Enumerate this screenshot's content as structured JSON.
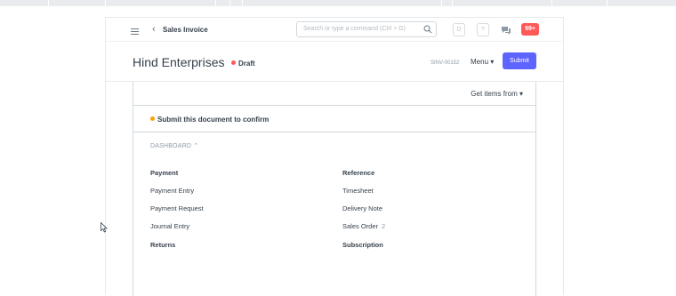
{
  "navbar": {
    "breadcrumb": "Sales Invoice",
    "search_placeholder": "Search or type a command (Ctrl + G)",
    "icon_d": "D",
    "icon_help": "?",
    "notification_count": "99+"
  },
  "header": {
    "title": "Hind Enterprises",
    "status": "Draft",
    "doc_id": "SINV-00152",
    "menu_label": "Menu ▾",
    "submit_label": "Submit"
  },
  "form": {
    "get_items_label": "Get items from ▾",
    "alert_text": "Submit this document to confirm"
  },
  "dashboard": {
    "label": "DASHBOARD ⌃",
    "columns": [
      {
        "heading": "Payment",
        "items": [
          "Payment Entry",
          "Payment Request",
          "Journal Entry"
        ],
        "next_heading": "Returns"
      },
      {
        "heading": "Reference",
        "items": [
          "Timesheet",
          "Delivery Note",
          "Sales Order"
        ],
        "count": "2",
        "next_heading": "Subscription"
      }
    ]
  },
  "colors": {
    "primary": "#5e64ff",
    "draft": "#ff5858",
    "warning": "#ffa00a"
  }
}
